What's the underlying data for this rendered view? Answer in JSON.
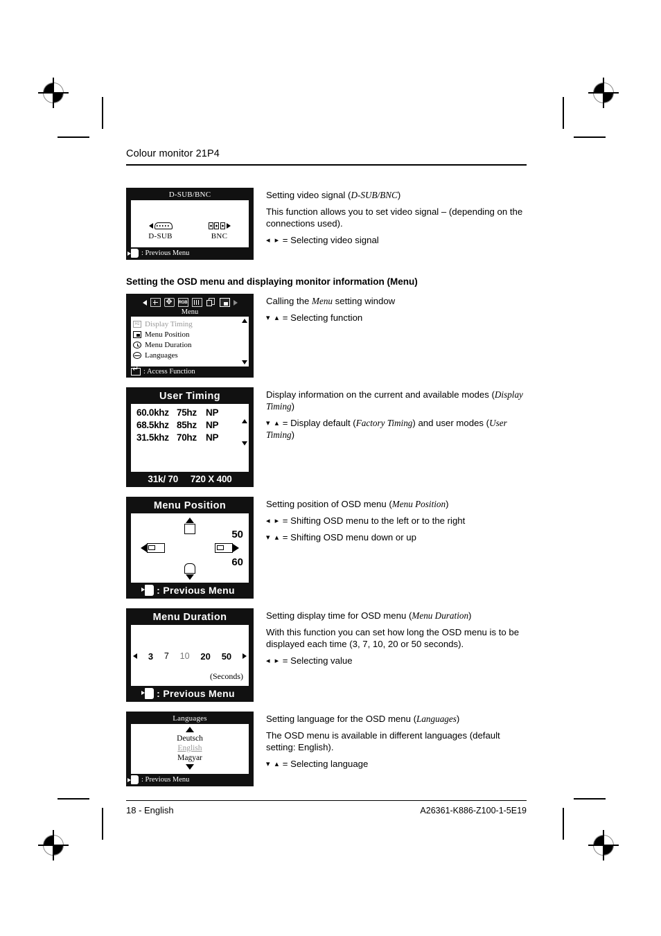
{
  "header": {
    "title": "Colour monitor 21P4"
  },
  "footer": {
    "page": "18 - English",
    "doc_id": "A26361-K886-Z100-1-5E19"
  },
  "sections": {
    "video_signal": {
      "title": "Setting video signal (D-SUB/BNC)",
      "title_plain": "Setting video signal (",
      "title_italic": "D-SUB/BNC",
      "title_close": ")",
      "body": "This function allows you to set video signal – (depending on the connections used).",
      "key_hint": "= Selecting video signal",
      "osd": {
        "title": "D-SUB/BNC",
        "left_label": "D-SUB",
        "right_label": "BNC",
        "footer": ": Previous Menu"
      }
    },
    "menu_heading": "Setting the OSD menu and displaying monitor information (Menu)",
    "menu": {
      "line1_pre": "Calling the ",
      "line1_italic": "Menu",
      "line1_post": " setting window",
      "key_hint": "= Selecting function",
      "osd": {
        "bar_label": "Menu",
        "icons": [
          "size-position-icon",
          "geometry-icon",
          "rgb-colour-icon",
          "moire-icon",
          "osd-icon",
          "menu-icon"
        ],
        "items": [
          {
            "icon": "Hz",
            "label": "Display Timing"
          },
          {
            "icon": "menu-position-icon",
            "label": "Menu Position"
          },
          {
            "icon": "clock-icon",
            "label": "Menu Duration"
          },
          {
            "icon": "languages-icon",
            "label": "Languages"
          }
        ],
        "footer": ": Access Function"
      }
    },
    "display_timing": {
      "body_pre": "Display information on the current and available modes (",
      "body_italic": "Display Timing",
      "body_post": ")",
      "key_pre": "= Display default (",
      "key_it1": "Factory Timing",
      "key_mid": ") and user modes (",
      "key_it2": "User Timing",
      "key_post": ")",
      "osd": {
        "title": "User Timing",
        "rows": [
          {
            "freq": "60.0khz",
            "rate": "75hz",
            "pol": "NP"
          },
          {
            "freq": "68.5khz",
            "rate": "85hz",
            "pol": "NP"
          },
          {
            "freq": "31.5khz",
            "rate": "70hz",
            "pol": "NP"
          }
        ],
        "footer_left": "31k/ 70",
        "footer_right": "720 X 400"
      }
    },
    "menu_position": {
      "title_pre": "Setting position of OSD menu (",
      "title_italic": "Menu Position",
      "title_post": ")",
      "key_hint_lr": "= Shifting OSD menu to the left or to the right",
      "key_hint_ud": "= Shifting OSD menu down or up",
      "osd": {
        "title": "Menu Position",
        "value_h": "50",
        "value_v": "60",
        "footer": ": Previous Menu"
      }
    },
    "menu_duration": {
      "title_pre": "Setting display time for OSD menu (",
      "title_italic": "Menu Duration",
      "title_post": ")",
      "body": "With this function you can set how long the OSD menu is to be displayed each time (3, 7, 10, 20 or 50 seconds).",
      "key_hint": "= Selecting value",
      "osd": {
        "title": "Menu Duration",
        "values": [
          "3",
          "7",
          "10",
          "20",
          "50"
        ],
        "unit": "(Seconds)",
        "footer": ": Previous Menu"
      }
    },
    "languages": {
      "title_pre": "Setting language for the OSD menu (",
      "title_italic": "Languages",
      "title_post": ")",
      "body": "The OSD menu is available in different languages (default setting: English).",
      "key_hint": "= Selecting language",
      "osd": {
        "title": "Languages",
        "items": [
          "Deutsch",
          "English",
          "Magyar"
        ],
        "selected": "English",
        "footer": ": Previous Menu"
      }
    }
  }
}
